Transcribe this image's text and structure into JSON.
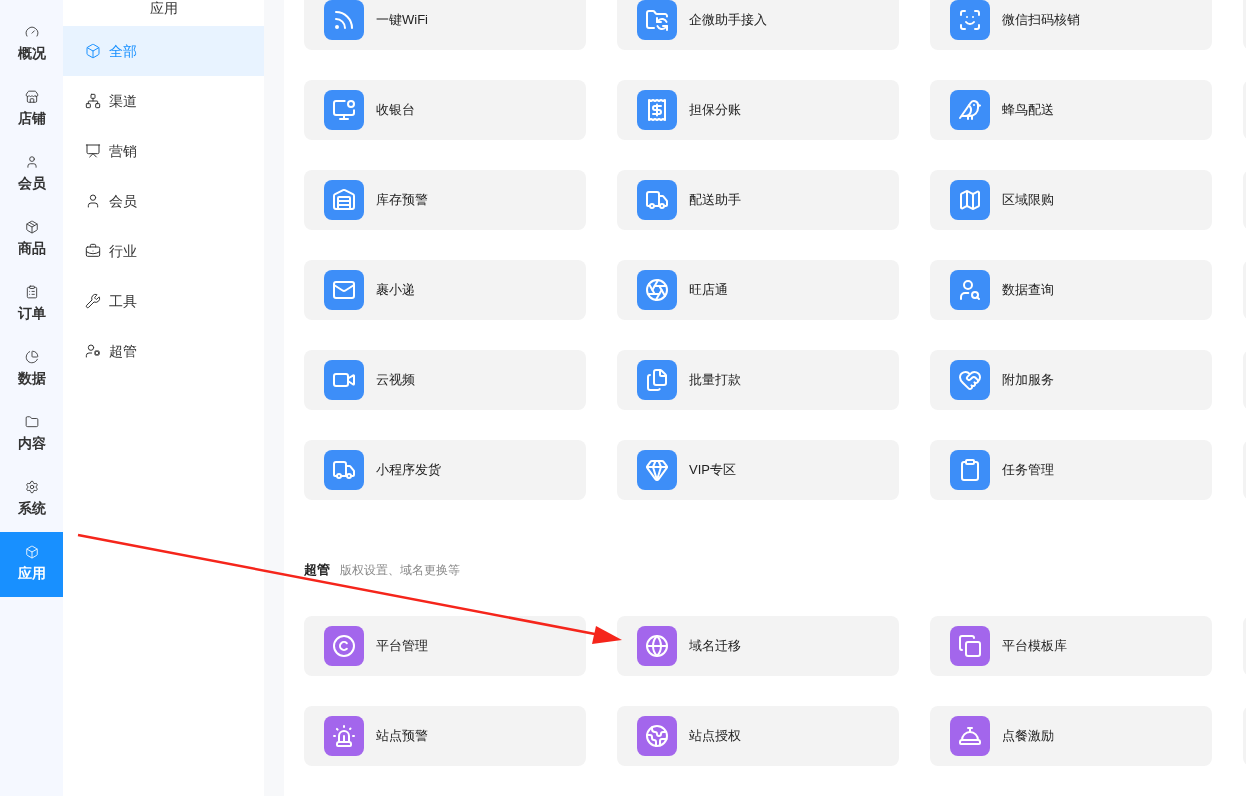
{
  "rail": [
    {
      "label": "概况",
      "selected": false
    },
    {
      "label": "店铺",
      "selected": false
    },
    {
      "label": "会员",
      "selected": false
    },
    {
      "label": "商品",
      "selected": false
    },
    {
      "label": "订单",
      "selected": false
    },
    {
      "label": "数据",
      "selected": false
    },
    {
      "label": "内容",
      "selected": false
    },
    {
      "label": "系统",
      "selected": false
    },
    {
      "label": "应用",
      "selected": true
    }
  ],
  "submenu": {
    "title": "应用",
    "items": [
      {
        "label": "全部",
        "selected": true
      },
      {
        "label": "渠道",
        "selected": false
      },
      {
        "label": "营销",
        "selected": false
      },
      {
        "label": "会员",
        "selected": false
      },
      {
        "label": "行业",
        "selected": false
      },
      {
        "label": "工具",
        "selected": false
      },
      {
        "label": "超管",
        "selected": false
      }
    ]
  },
  "sections": [
    {
      "color": "#3d8ef8",
      "apps": [
        "一键WiFi",
        "企微助手接入",
        "微信扫码核销",
        "收银台",
        "担保分账",
        "蜂鸟配送",
        "库存预警",
        "配送助手",
        "区域限购",
        "裹小递",
        "旺店通",
        "数据查询",
        "云视频",
        "批量打款",
        "附加服务",
        "小程序发货",
        "VIP专区",
        "任务管理"
      ]
    },
    {
      "title": "超管",
      "subtitle": "版权设置、域名更换等",
      "color": "#a366ec",
      "apps": [
        "平台管理",
        "域名迁移",
        "平台模板库",
        "站点预警",
        "站点授权",
        "点餐激励"
      ]
    }
  ]
}
